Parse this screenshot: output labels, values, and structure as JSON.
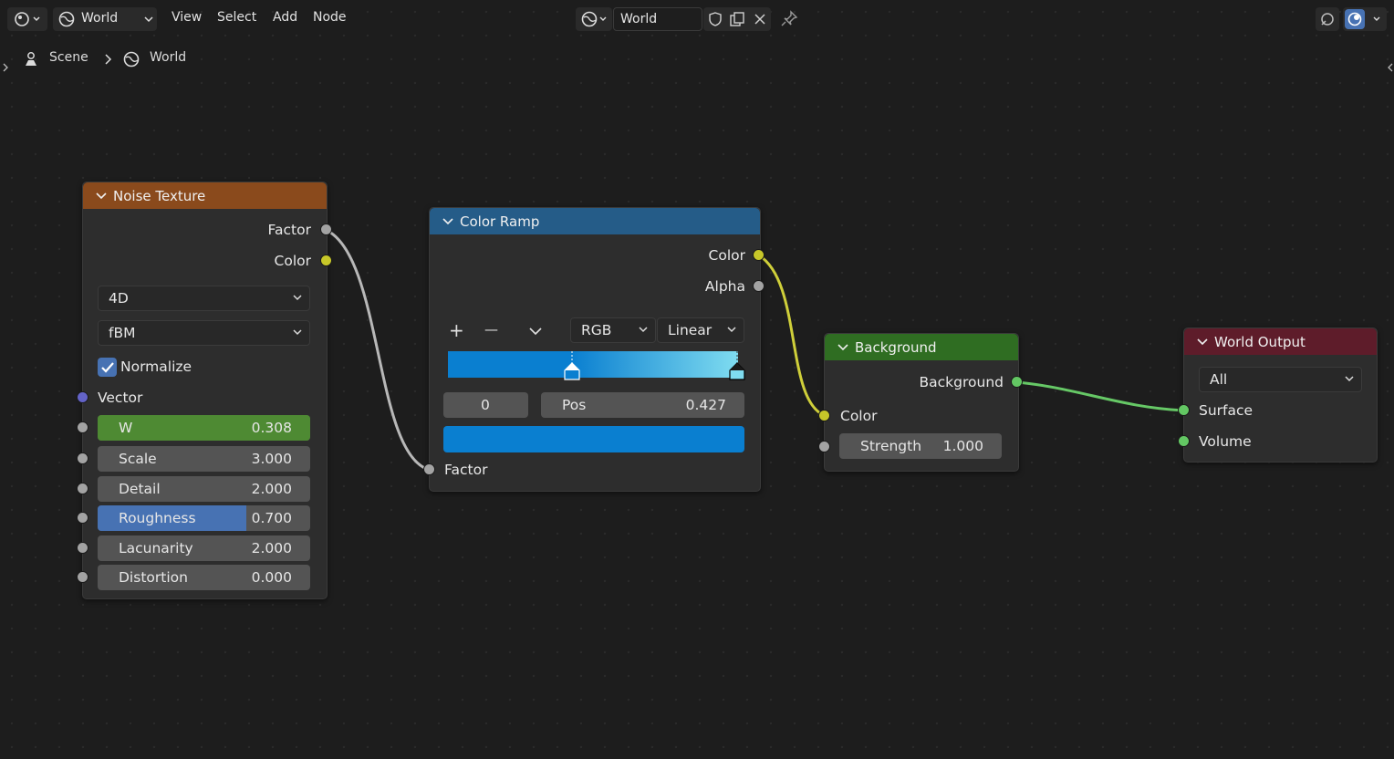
{
  "header": {
    "editor_selector": "World",
    "menus": [
      "View",
      "Select",
      "Add",
      "Node"
    ],
    "world_datablock": "World"
  },
  "breadcrumb": {
    "scene": "Scene",
    "world": "World"
  },
  "nodes": {
    "noise": {
      "title": "Noise Texture",
      "outputs": [
        "Factor",
        "Color"
      ],
      "dimensions": "4D",
      "noise_type": "fBM",
      "normalize_label": "Normalize",
      "normalize_checked": true,
      "vector_label": "Vector",
      "fields": [
        {
          "label": "W",
          "value": "0.308",
          "fill": 1.0,
          "color": "#4e8a33"
        },
        {
          "label": "Scale",
          "value": "3.000",
          "fill": 0,
          "color": "#4772b3"
        },
        {
          "label": "Detail",
          "value": "2.000",
          "fill": 0,
          "color": "#4772b3"
        },
        {
          "label": "Roughness",
          "value": "0.700",
          "fill": 0.7,
          "color": "#4772b3"
        },
        {
          "label": "Lacunarity",
          "value": "2.000",
          "fill": 0,
          "color": "#4772b3"
        },
        {
          "label": "Distortion",
          "value": "0.000",
          "fill": 0,
          "color": "#4772b3"
        }
      ]
    },
    "ramp": {
      "title": "Color Ramp",
      "outputs": [
        "Color",
        "Alpha"
      ],
      "add": "+",
      "remove": "—",
      "color_mode": "RGB",
      "interpolation": "Linear",
      "stop_index": "0",
      "pos_label": "Pos",
      "pos_value": "0.427",
      "active_color": "#0a7fd0",
      "input": "Factor"
    },
    "background": {
      "title": "Background",
      "output": "Background",
      "color_label": "Color",
      "strength_label": "Strength",
      "strength_value": "1.000"
    },
    "output": {
      "title": "World Output",
      "target": "All",
      "inputs": [
        "Surface",
        "Volume"
      ]
    }
  },
  "colors": {
    "noise_header": "#8a4a1c",
    "ramp_header": "#255c88",
    "background_header": "#2f6d22",
    "output_header": "#5e1c2a",
    "socket_gray": "#a3a3a3",
    "socket_yellow": "#c7c729",
    "socket_green": "#63c763",
    "socket_purple": "#6363c7"
  }
}
